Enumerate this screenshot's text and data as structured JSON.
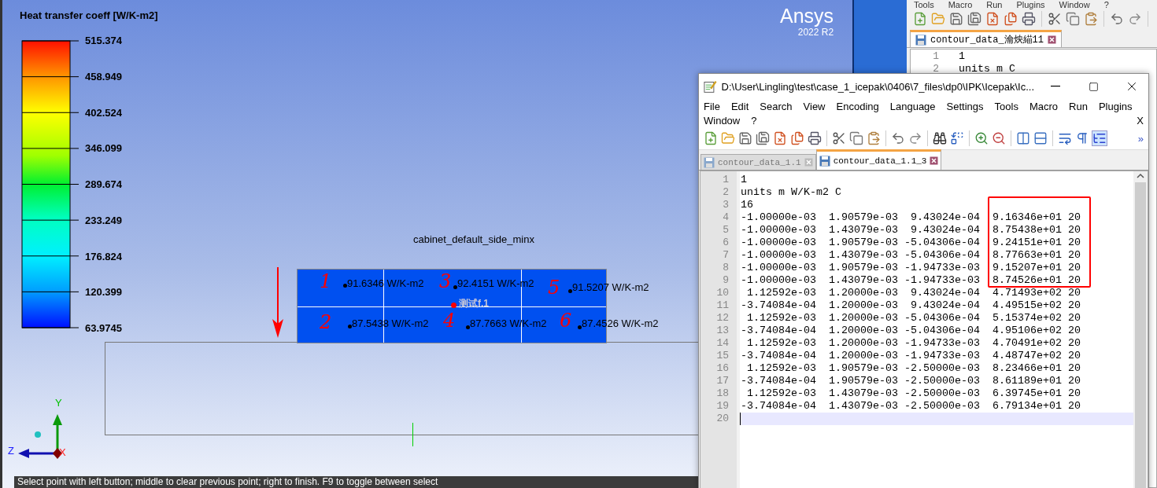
{
  "viewport": {
    "legend": {
      "title": "Heat transfer coeff [W/K-m2]",
      "labels": [
        "515.374",
        "458.949",
        "402.524",
        "346.099",
        "289.674",
        "233.249",
        "176.824",
        "120.399",
        "63.9745"
      ]
    },
    "logo": {
      "name": "Ansys",
      "version": "2022 R2"
    },
    "model": {
      "part_name": "cabinet_default_side_minx",
      "probe_label": "测试f.1",
      "probes": [
        {
          "marker": "1",
          "value": "91.6346 W/K-m2"
        },
        {
          "marker": "3",
          "value": "92.4151 W/K-m2"
        },
        {
          "marker": "5",
          "value": "91.5207 W/K-m2"
        },
        {
          "marker": "2",
          "value": "87.5438 W/K-m2"
        },
        {
          "marker": "4",
          "value": "87.7663 W/K-m2"
        },
        {
          "marker": "6",
          "value": "87.4526 W/K-m2"
        }
      ]
    },
    "axes": {
      "y": "Y",
      "z": "Z",
      "x": "X"
    },
    "status": "Select point with left button; middle to clear previous point; right to finish. F9 to toggle between select"
  },
  "back_editor": {
    "menu": [
      "Tools",
      "Macro",
      "Run",
      "Plugins",
      "Window",
      "?"
    ],
    "tab": "contour_data_瀹炴緢11",
    "lines": [
      {
        "number": "1",
        "text": "1"
      },
      {
        "number": "2",
        "text": "units m C"
      }
    ]
  },
  "editor": {
    "title": "D:\\User\\Lingling\\test\\case_1_icepak\\0406\\7_files\\dp0\\IPK\\Icepak\\Ic...",
    "menu": [
      "File",
      "Edit",
      "Search",
      "View",
      "Encoding",
      "Language",
      "Settings",
      "Tools",
      "Macro",
      "Run",
      "Plugins"
    ],
    "menu_row2": [
      "Window",
      "?"
    ],
    "close_doc": "X",
    "overflow": "»",
    "tabs": [
      {
        "label": "contour_data_1.1",
        "selected": false
      },
      {
        "label": "contour_data_1.1_3",
        "selected": true
      }
    ],
    "lines": [
      {
        "number": "1",
        "text": "1",
        "current": false
      },
      {
        "number": "2",
        "text": "units m W/K-m2 C",
        "current": false
      },
      {
        "number": "3",
        "text": "16",
        "current": false
      },
      {
        "number": "4",
        "text": "-1.00000e-03  1.90579e-03  9.43024e-04  9.16346e+01 20",
        "current": false
      },
      {
        "number": "5",
        "text": "-1.00000e-03  1.43079e-03  9.43024e-04  8.75438e+01 20",
        "current": false
      },
      {
        "number": "6",
        "text": "-1.00000e-03  1.90579e-03 -5.04306e-04  9.24151e+01 20",
        "current": false
      },
      {
        "number": "7",
        "text": "-1.00000e-03  1.43079e-03 -5.04306e-04  8.77663e+01 20",
        "current": false
      },
      {
        "number": "8",
        "text": "-1.00000e-03  1.90579e-03 -1.94733e-03  9.15207e+01 20",
        "current": false
      },
      {
        "number": "9",
        "text": "-1.00000e-03  1.43079e-03 -1.94733e-03  8.74526e+01 20",
        "current": false
      },
      {
        "number": "10",
        "text": " 1.12592e-03  1.20000e-03  9.43024e-04  4.71493e+02 20",
        "current": false
      },
      {
        "number": "11",
        "text": "-3.74084e-04  1.20000e-03  9.43024e-04  4.49515e+02 20",
        "current": false
      },
      {
        "number": "12",
        "text": " 1.12592e-03  1.20000e-03 -5.04306e-04  5.15374e+02 20",
        "current": false
      },
      {
        "number": "13",
        "text": "-3.74084e-04  1.20000e-03 -5.04306e-04  4.95106e+02 20",
        "current": false
      },
      {
        "number": "14",
        "text": " 1.12592e-03  1.20000e-03 -1.94733e-03  4.70491e+02 20",
        "current": false
      },
      {
        "number": "15",
        "text": "-3.74084e-04  1.20000e-03 -1.94733e-03  4.48747e+02 20",
        "current": false
      },
      {
        "number": "16",
        "text": " 1.12592e-03  1.90579e-03 -2.50000e-03  8.23466e+01 20",
        "current": false
      },
      {
        "number": "17",
        "text": "-3.74084e-04  1.90579e-03 -2.50000e-03  8.61189e+01 20",
        "current": false
      },
      {
        "number": "18",
        "text": " 1.12592e-03  1.43079e-03 -2.50000e-03  6.39745e+01 20",
        "current": false
      },
      {
        "number": "19",
        "text": "-3.74084e-04  1.43079e-03 -2.50000e-03  6.79134e+01 20",
        "current": false
      },
      {
        "number": "20",
        "current": true
      }
    ]
  }
}
